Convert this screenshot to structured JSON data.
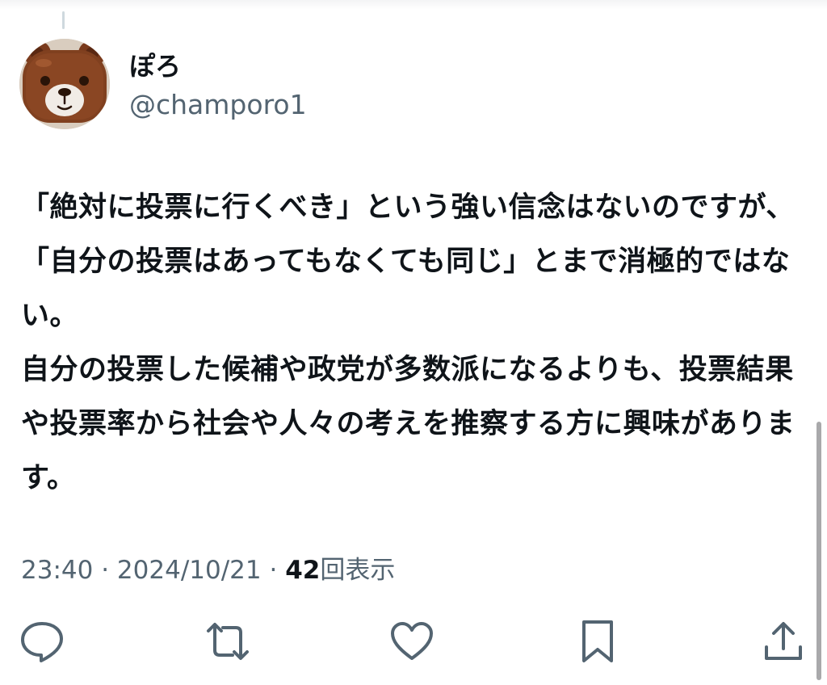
{
  "author": {
    "display_name": "ぽろ",
    "handle": "@champoro1"
  },
  "tweet": {
    "text": "「絶対に投票に行くべき」という強い信念はないのですが、「自分の投票はあってもなくても同じ」とまで消極的ではない。\n自分の投票した候補や政党が多数派になるよりも、投票結果や投票率から社会や人々の考えを推察する方に興味があります。"
  },
  "meta": {
    "time": "23:40",
    "separator": "·",
    "date": "2024/10/21",
    "views_count": "42",
    "views_label": "回表示"
  },
  "actions": [
    {
      "name": "reply",
      "icon": "speech-bubble-icon"
    },
    {
      "name": "retweet",
      "icon": "retweet-icon"
    },
    {
      "name": "like",
      "icon": "heart-icon"
    },
    {
      "name": "bookmark",
      "icon": "bookmark-icon"
    },
    {
      "name": "share",
      "icon": "share-icon"
    }
  ],
  "colors": {
    "text_primary": "#0f1419",
    "text_secondary": "#536471",
    "background": "#ffffff"
  }
}
